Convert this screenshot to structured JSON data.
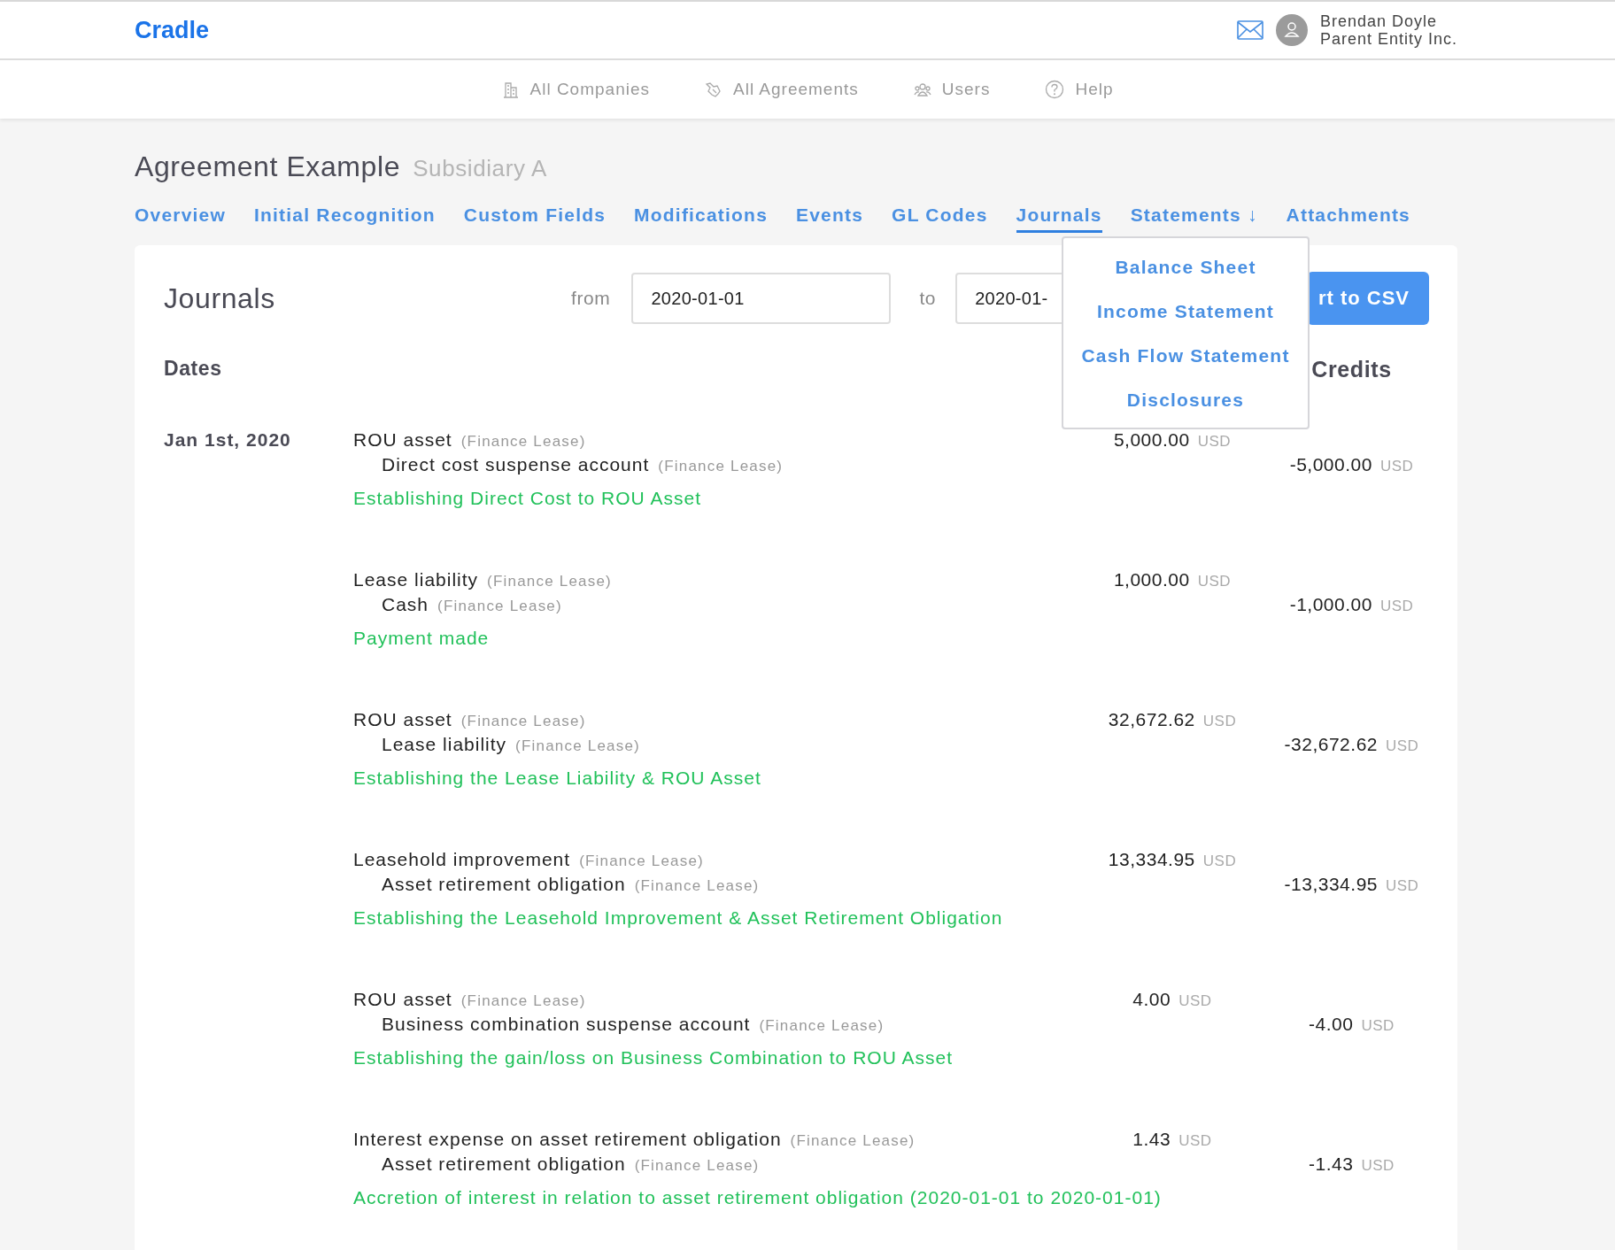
{
  "header": {
    "logo": "Cradle",
    "user_name": "Brendan Doyle",
    "user_company": "Parent Entity Inc."
  },
  "nav": [
    {
      "label": "All Companies"
    },
    {
      "label": "All Agreements"
    },
    {
      "label": "Users"
    },
    {
      "label": "Help"
    }
  ],
  "page": {
    "title": "Agreement Example",
    "subtitle": "Subsidiary A"
  },
  "tabs": [
    {
      "label": "Overview",
      "selected": false
    },
    {
      "label": "Initial Recognition",
      "selected": false
    },
    {
      "label": "Custom Fields",
      "selected": false
    },
    {
      "label": "Modifications",
      "selected": false
    },
    {
      "label": "Events",
      "selected": false
    },
    {
      "label": "GL Codes",
      "selected": false
    },
    {
      "label": "Journals",
      "selected": true
    },
    {
      "label": "Statements ↓",
      "selected": false
    },
    {
      "label": "Attachments",
      "selected": false
    }
  ],
  "dropdown": {
    "items": [
      "Balance Sheet",
      "Income Statement",
      "Cash Flow Statement",
      "Disclosures"
    ]
  },
  "journals": {
    "title": "Journals",
    "from_label": "from",
    "from_value": "2020-01-01",
    "to_label": "to",
    "to_value": "2020-01-",
    "export_button": "rt to CSV",
    "dates_header": "Dates",
    "credits_header": "Credits",
    "entries": [
      {
        "date": "Jan 1st, 2020",
        "debit_account": "ROU asset",
        "debit_type": "(Finance Lease)",
        "credit_account": "Direct cost suspense account",
        "credit_type": "(Finance Lease)",
        "description": "Establishing Direct Cost to ROU Asset",
        "debit": "5,000.00",
        "debit_currency": "USD",
        "credit": "-5,000.00",
        "credit_currency": "USD"
      },
      {
        "debit_account": "Lease liability",
        "debit_type": "(Finance Lease)",
        "credit_account": "Cash",
        "credit_type": "(Finance Lease)",
        "description": "Payment made",
        "debit": "1,000.00",
        "debit_currency": "USD",
        "credit": "-1,000.00",
        "credit_currency": "USD"
      },
      {
        "debit_account": "ROU asset",
        "debit_type": "(Finance Lease)",
        "credit_account": "Lease liability",
        "credit_type": "(Finance Lease)",
        "description": "Establishing the Lease Liability & ROU Asset",
        "debit": "32,672.62",
        "debit_currency": "USD",
        "credit": "-32,672.62",
        "credit_currency": "USD"
      },
      {
        "debit_account": "Leasehold improvement",
        "debit_type": "(Finance Lease)",
        "credit_account": "Asset retirement obligation",
        "credit_type": "(Finance Lease)",
        "description": "Establishing the Leasehold Improvement & Asset Retirement Obligation",
        "debit": "13,334.95",
        "debit_currency": "USD",
        "credit": "-13,334.95",
        "credit_currency": "USD"
      },
      {
        "debit_account": "ROU asset",
        "debit_type": "(Finance Lease)",
        "credit_account": "Business combination suspense account",
        "credit_type": "(Finance Lease)",
        "description": "Establishing the gain/loss on Business Combination to ROU Asset",
        "debit": "4.00",
        "debit_currency": "USD",
        "credit": "-4.00",
        "credit_currency": "USD"
      },
      {
        "debit_account": "Interest expense on asset retirement obligation",
        "debit_type": "(Finance Lease)",
        "credit_account": "Asset retirement obligation",
        "credit_type": "(Finance Lease)",
        "description": "Accretion of interest in relation to asset retirement obligation (2020-01-01 to 2020-01-01)",
        "debit": "1.43",
        "debit_currency": "USD",
        "credit": "-1.43",
        "credit_currency": "USD"
      }
    ]
  }
}
